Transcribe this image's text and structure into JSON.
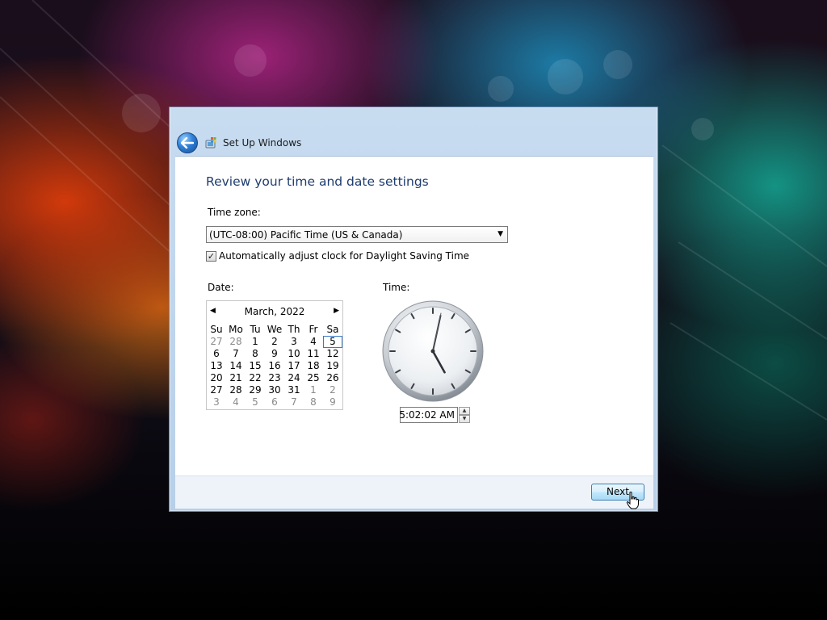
{
  "window": {
    "title": "Set Up Windows",
    "icons": {
      "back": "back-arrow-icon",
      "app": "setup-windows-icon"
    }
  },
  "page": {
    "heading": "Review your time and date settings"
  },
  "timezone": {
    "label": "Time zone:",
    "selected": "(UTC-08:00) Pacific Time (US & Canada)"
  },
  "dst": {
    "label": "Automatically adjust clock for Daylight Saving Time",
    "checked": true,
    "check_mark": "✓"
  },
  "date": {
    "label": "Date:",
    "calendar": {
      "month_title": "March, 2022",
      "prev_icon": "◀",
      "next_icon": "▶",
      "weekdays": [
        "Su",
        "Mo",
        "Tu",
        "We",
        "Th",
        "Fr",
        "Sa"
      ],
      "weeks": [
        [
          "27",
          "28",
          "1",
          "2",
          "3",
          "4",
          "5"
        ],
        [
          "6",
          "7",
          "8",
          "9",
          "10",
          "11",
          "12"
        ],
        [
          "13",
          "14",
          "15",
          "16",
          "17",
          "18",
          "19"
        ],
        [
          "20",
          "21",
          "22",
          "23",
          "24",
          "25",
          "26"
        ],
        [
          "27",
          "28",
          "29",
          "30",
          "31",
          "1",
          "2"
        ],
        [
          "3",
          "4",
          "5",
          "6",
          "7",
          "8",
          "9"
        ]
      ],
      "other_month_flags": [
        [
          true,
          true,
          false,
          false,
          false,
          false,
          false
        ],
        [
          false,
          false,
          false,
          false,
          false,
          false,
          false
        ],
        [
          false,
          false,
          false,
          false,
          false,
          false,
          false
        ],
        [
          false,
          false,
          false,
          false,
          false,
          false,
          false
        ],
        [
          false,
          false,
          false,
          false,
          false,
          true,
          true
        ],
        [
          true,
          true,
          true,
          true,
          true,
          true,
          true
        ]
      ],
      "selected_day": "5"
    }
  },
  "time": {
    "label": "Time:",
    "value": "5:02:02 AM",
    "clock": {
      "hour": 5,
      "minute": 2,
      "second": 2
    },
    "spin_up": "▲",
    "spin_down": "▼"
  },
  "footer": {
    "next_label": "Next"
  },
  "colors": {
    "heading": "#1e3c6e",
    "frame": "#b7cfe9",
    "selected_day_border": "#3a79c8"
  }
}
